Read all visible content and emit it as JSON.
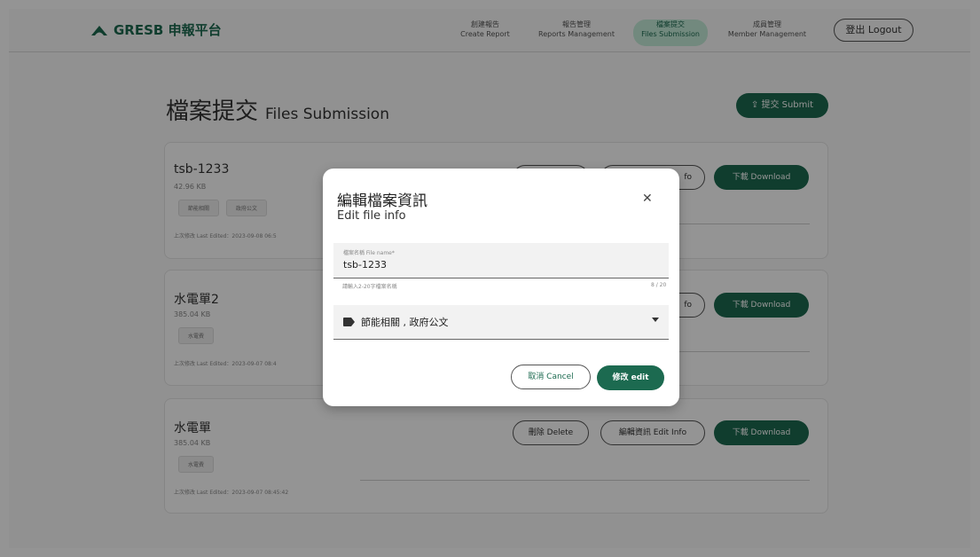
{
  "header": {
    "brand": "GRESB 申報平台",
    "nav": [
      {
        "zh": "創建報告",
        "en": "Create Report"
      },
      {
        "zh": "報告管理",
        "en": "Reports Management"
      },
      {
        "zh": "檔案提交",
        "en": "Files Submission"
      },
      {
        "zh": "成員管理",
        "en": "Member Management"
      }
    ],
    "active_nav": "Files Submission",
    "logout_label": "登出 Logout"
  },
  "page": {
    "title_zh": "檔案提交",
    "title_en": "Files Submission",
    "submit_label": "⇪ 提交 Submit"
  },
  "files": [
    {
      "name": "tsb-1233",
      "size": "42.96 KB",
      "tags": [
        "節能相關",
        "政府公文"
      ],
      "edited": "上次修改 Last Edited：2023-09-08 06:5"
    },
    {
      "name": "水電單2",
      "size": "385.04 KB",
      "tags": [
        "水電費"
      ],
      "edited": "上次修改 Last Edited：2023-09-07 08:4"
    },
    {
      "name": "水電單",
      "size": "385.04 KB",
      "tags": [
        "水電費"
      ],
      "edited": "上次修改 Last Edited：2023-09-07 08:45:42"
    }
  ],
  "buttons": {
    "delete": "刪除 Delete",
    "edit_info": "編輯資訊 Edit Info",
    "edit_info_partial": "fo",
    "download": "下載 Download"
  },
  "dialog": {
    "title_zh": "編輯檔案資訊",
    "title_en": "Edit file info",
    "field_label": "檔案名稱 File name*",
    "field_value": "tsb-1233",
    "hint": "請輸入2-20字檔案名稱",
    "counter": "8 / 20",
    "tags_value": "節能相關 , 政府公文",
    "cancel_label": "取消 Cancel",
    "confirm_label": "修改 edit"
  },
  "colors": {
    "brand": "#1c6a50",
    "active_nav_bg": "#c5ecd9"
  },
  "icons": {
    "logo": "gresb-logo-icon",
    "close": "close-icon",
    "tag": "label-icon",
    "caret": "caret-down-icon"
  }
}
